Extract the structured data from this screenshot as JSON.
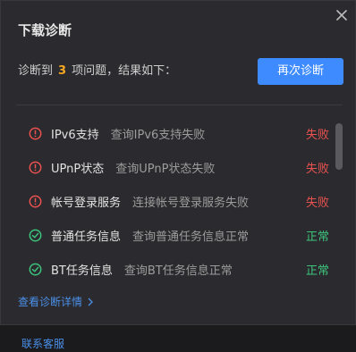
{
  "dialog": {
    "title": "下载诊断",
    "close_icon": "close-icon"
  },
  "summary": {
    "prefix": "诊断到",
    "count": "3",
    "suffix": "项问题，结果如下："
  },
  "retry_button": {
    "label": "再次诊断",
    "color": "#3d8bff"
  },
  "results": [
    {
      "name": "IPv6支持",
      "desc": "查询IPv6支持失败",
      "status": "失败",
      "state": "fail",
      "icon": "error-icon"
    },
    {
      "name": "UPnP状态",
      "desc": "查询UPnP状态失败",
      "status": "失败",
      "state": "fail",
      "icon": "error-icon"
    },
    {
      "name": "帐号登录服务",
      "desc": "连接帐号登录服务失败",
      "status": "失败",
      "state": "fail",
      "icon": "error-icon"
    },
    {
      "name": "普通任务信息",
      "desc": "查询普通任务信息正常",
      "status": "正常",
      "state": "ok",
      "icon": "check-icon"
    },
    {
      "name": "BT任务信息",
      "desc": "查询BT任务信息正常",
      "status": "正常",
      "state": "ok",
      "icon": "check-icon"
    }
  ],
  "colors": {
    "fail": "#e9524f",
    "ok": "#3cc47c",
    "count": "#f5a623",
    "link": "#4a8fe8"
  },
  "links": {
    "details": "查看诊断详情",
    "support": "联系客服"
  }
}
